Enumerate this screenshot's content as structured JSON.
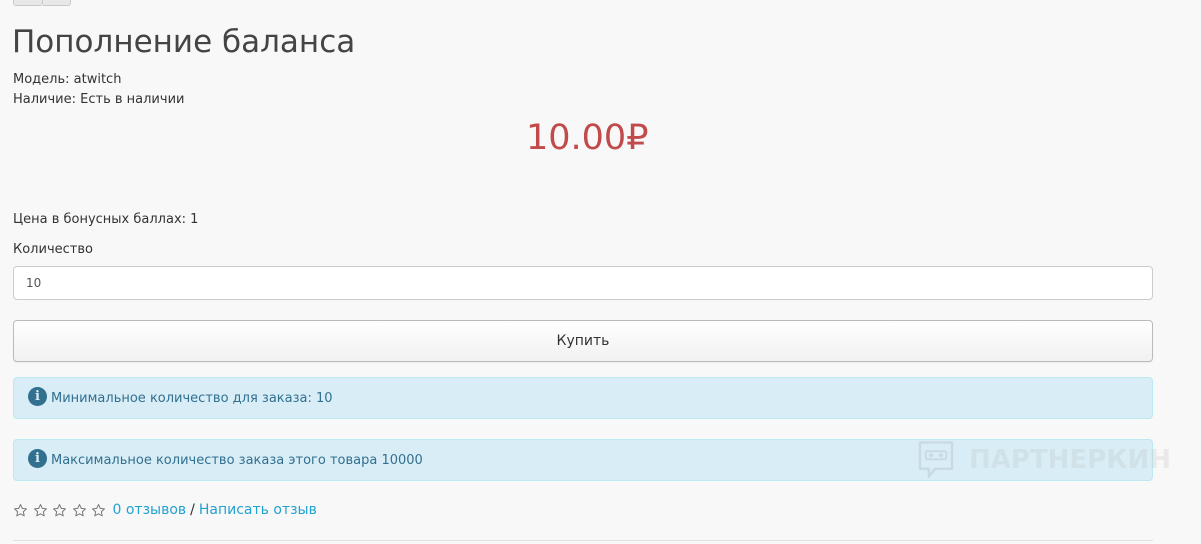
{
  "product": {
    "title": "Пополнение баланса",
    "model_line": "Модель: atwitch",
    "stock_line": "Наличие: Есть в наличии",
    "price": "10.00₽",
    "bonus_line": "Цена в бонусных баллах: 1"
  },
  "quantity": {
    "label": "Количество",
    "value": "10"
  },
  "buy": {
    "label": "Купить"
  },
  "alerts": {
    "min": "Минимальное количество для заказа: 10",
    "max": "Максимальное количество заказа этого товара 10000"
  },
  "rating": {
    "stars": 0,
    "max_stars": 5,
    "reviews_link": "0 отзывов",
    "separator": "/",
    "write_link": "Написать отзыв"
  },
  "watermark": {
    "text": "ПАРТНЕРКИН"
  },
  "colors": {
    "price": "#c14a4a",
    "link": "#23a1d1",
    "alert_bg": "#d9edf7",
    "alert_text": "#31708f"
  },
  "icons": {
    "alert": "info-circle-icon",
    "rating": "star-outline-icon"
  }
}
